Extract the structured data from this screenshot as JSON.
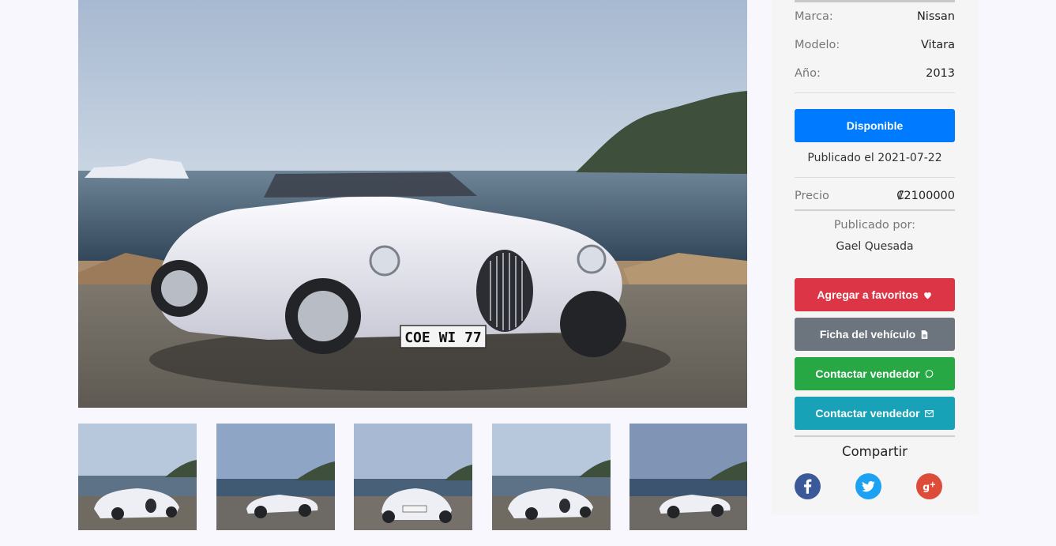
{
  "gallery": {
    "main_image": "white-roadster-seaside-photo",
    "thumbnails": [
      {
        "view": "front-three-quarter"
      },
      {
        "view": "side"
      },
      {
        "view": "rear-three-quarter"
      },
      {
        "view": "front-three-quarter"
      },
      {
        "view": "side"
      }
    ]
  },
  "vehicle": {
    "plate": "COE WI 77",
    "specs": [
      {
        "label": "Marca:",
        "value": "Nissan"
      },
      {
        "label": "Modelo:",
        "value": "Vitara"
      },
      {
        "label": "Año:",
        "value": "2013"
      }
    ],
    "status_label": "Disponible",
    "published_date": "Publicado el 2021-07-22",
    "price_label": "Precio",
    "price_value": "₡2100000",
    "published_by_label": "Publicado por:",
    "seller_name": "Gael Quesada"
  },
  "actions": {
    "favorite": "Agregar a favoritos",
    "spec_sheet": "Ficha del vehículo",
    "contact_whatsapp": "Contactar vendedor",
    "contact_email": "Contactar vendedor"
  },
  "share": {
    "title": "Compartir",
    "networks": [
      "facebook-icon",
      "twitter-icon",
      "google-plus-icon"
    ]
  },
  "colors": {
    "primary": "#007bff",
    "danger": "#dc3545",
    "secondary": "#6c757d",
    "success": "#28a745",
    "info": "#17a2b8"
  }
}
